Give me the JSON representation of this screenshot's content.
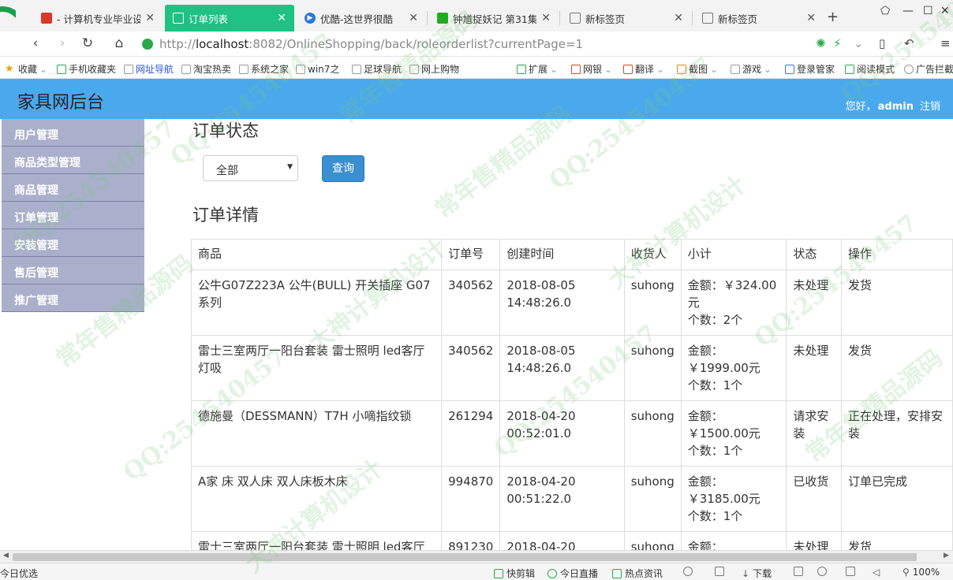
{
  "browser": {
    "tabs": [
      {
        "label": "- 计算机专业毕业设",
        "icon": "flag-icon",
        "color": "#d83a2a",
        "left": 0
      },
      {
        "label": "订单列表",
        "icon": "page-icon",
        "color": "#ffffff",
        "active": true
      },
      {
        "label": "优酷-这世界很酷",
        "icon": "youku-icon",
        "color": "#2a7ad8"
      },
      {
        "label": "钟馗捉妖记 第31集",
        "icon": "iqiyi-icon",
        "color": "#22aa22"
      },
      {
        "label": "新标签页",
        "icon": "grid-icon",
        "color": "#777777"
      },
      {
        "label": "新标签页",
        "icon": "grid-icon",
        "color": "#777777"
      }
    ],
    "url_prefix": "http://",
    "url_host": "localhost",
    "url_rest": ":8082/OnlineShopping/back/roleorderlist?currentPage=1",
    "bookmarks_left": [
      "收藏",
      "手机收藏夹",
      "网址导航",
      "淘宝热卖",
      "系统之家",
      "win7之",
      "足球导航",
      "网上购物"
    ],
    "bookmarks_right": [
      "扩展",
      "网银",
      "翻译",
      "截图",
      "游戏",
      "登录管家",
      "阅读模式",
      "广告拦截"
    ],
    "status_left": "今日优选",
    "status_items": [
      "快剪辑",
      "今日直播",
      "热点资讯",
      "下载",
      "100%"
    ]
  },
  "app": {
    "brand": "家具网后台",
    "greeting": "您好，",
    "username": "admin",
    "logout": "注销"
  },
  "sidebar": {
    "items": [
      "用户管理",
      "商品类型管理",
      "商品管理",
      "订单管理",
      "安装管理",
      "售后管理",
      "推广管理"
    ]
  },
  "filter": {
    "title": "订单状态",
    "select_value": "全部",
    "query_label": "查询"
  },
  "details": {
    "title": "订单详情",
    "headers": [
      "商品",
      "订单号",
      "创建时间",
      "收货人",
      "小计",
      "状态",
      "操作"
    ],
    "rows": [
      {
        "product": "公牛G07Z223A 公牛(BULL) 开关插座 G07系列",
        "order_no": "340562",
        "created": "2018-08-05 14:48:26.0",
        "receiver": "suhong",
        "amount": "金额：￥324.00元",
        "count": "个数：2个",
        "status": "未处理",
        "action": "发货"
      },
      {
        "product": "雷士三室两厅一阳台套装 雷士照明 led客厅灯吸",
        "order_no": "340562",
        "created": "2018-08-05 14:48:26.0",
        "receiver": "suhong",
        "amount": "金额：￥1999.00元",
        "count": "个数：1个",
        "status": "未处理",
        "action": "发货"
      },
      {
        "product": "德施曼（DESSMANN）T7H 小嘀指纹锁",
        "order_no": "261294",
        "created": "2018-04-20 00:52:01.0",
        "receiver": "suhong",
        "amount": "金额：￥1500.00元",
        "count": "个数：1个",
        "status": "请求安装",
        "action": "正在处理，安排安装"
      },
      {
        "product": "A家 床 双人床 双人床板木床",
        "order_no": "994870",
        "created": "2018-04-20 00:51:22.0",
        "receiver": "suhong",
        "amount": "金额：￥3185.00元",
        "count": "个数：1个",
        "status": "已收货",
        "action": "订单已完成"
      },
      {
        "product": "雷士三室两厅一阳台套装 雷士照明 led客厅灯吸",
        "order_no": "891230",
        "created": "2018-04-20",
        "receiver": "suhong",
        "amount": "金额：",
        "count": "",
        "status": "未处理",
        "action": "发货"
      }
    ]
  },
  "watermark": [
    "QQ:254540457",
    "大神计算机设计",
    "常年售精品源码"
  ]
}
